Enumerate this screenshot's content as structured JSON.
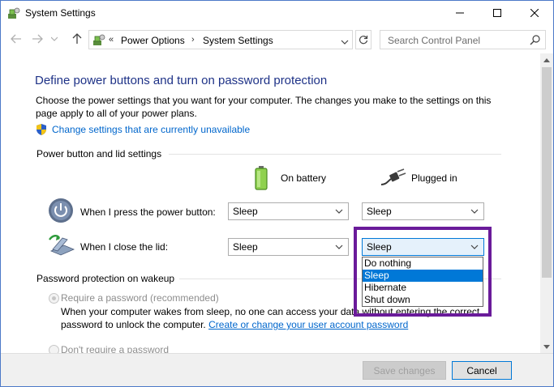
{
  "window": {
    "title": "System Settings",
    "controls": {
      "minimize": "minimize",
      "maximize": "maximize",
      "close": "close"
    }
  },
  "nav": {
    "breadcrumb_prefix": "«",
    "breadcrumb": [
      "Power Options",
      "System Settings"
    ],
    "separator": "›",
    "search_placeholder": "Search Control Panel"
  },
  "page": {
    "title": "Define power buttons and turn on password protection",
    "description": "Choose the power settings that you want for your computer. The changes you make to the settings on this page apply to all of your power plans.",
    "change_link": "Change settings that are currently unavailable",
    "section_power": "Power button and lid settings",
    "col_battery": "On battery",
    "col_plugged": "Plugged in",
    "rows": [
      {
        "label": "When I press the power button:",
        "battery": "Sleep",
        "plugged": "Sleep"
      },
      {
        "label": "When I close the lid:",
        "battery": "Sleep",
        "plugged": "Sleep"
      }
    ],
    "dropdown_options": [
      "Do nothing",
      "Sleep",
      "Hibernate",
      "Shut down"
    ],
    "dropdown_selected_index": 1,
    "section_password": "Password protection on wakeup",
    "require_password_label": "Require a password (recommended)",
    "require_password_desc_1": "When your computer wakes from sleep, no one can access your data without entering the correct",
    "require_password_desc_2": "password to unlock the computer.",
    "create_password_link": "Create or change your user account password",
    "no_password_label": "Don't require a password"
  },
  "footer": {
    "save_label": "Save changes",
    "cancel_label": "Cancel"
  },
  "colors": {
    "title_blue": "#1e3287",
    "link_blue": "#0066cc",
    "highlight_purple": "#6a1b9a",
    "selection_blue": "#0078d7"
  }
}
